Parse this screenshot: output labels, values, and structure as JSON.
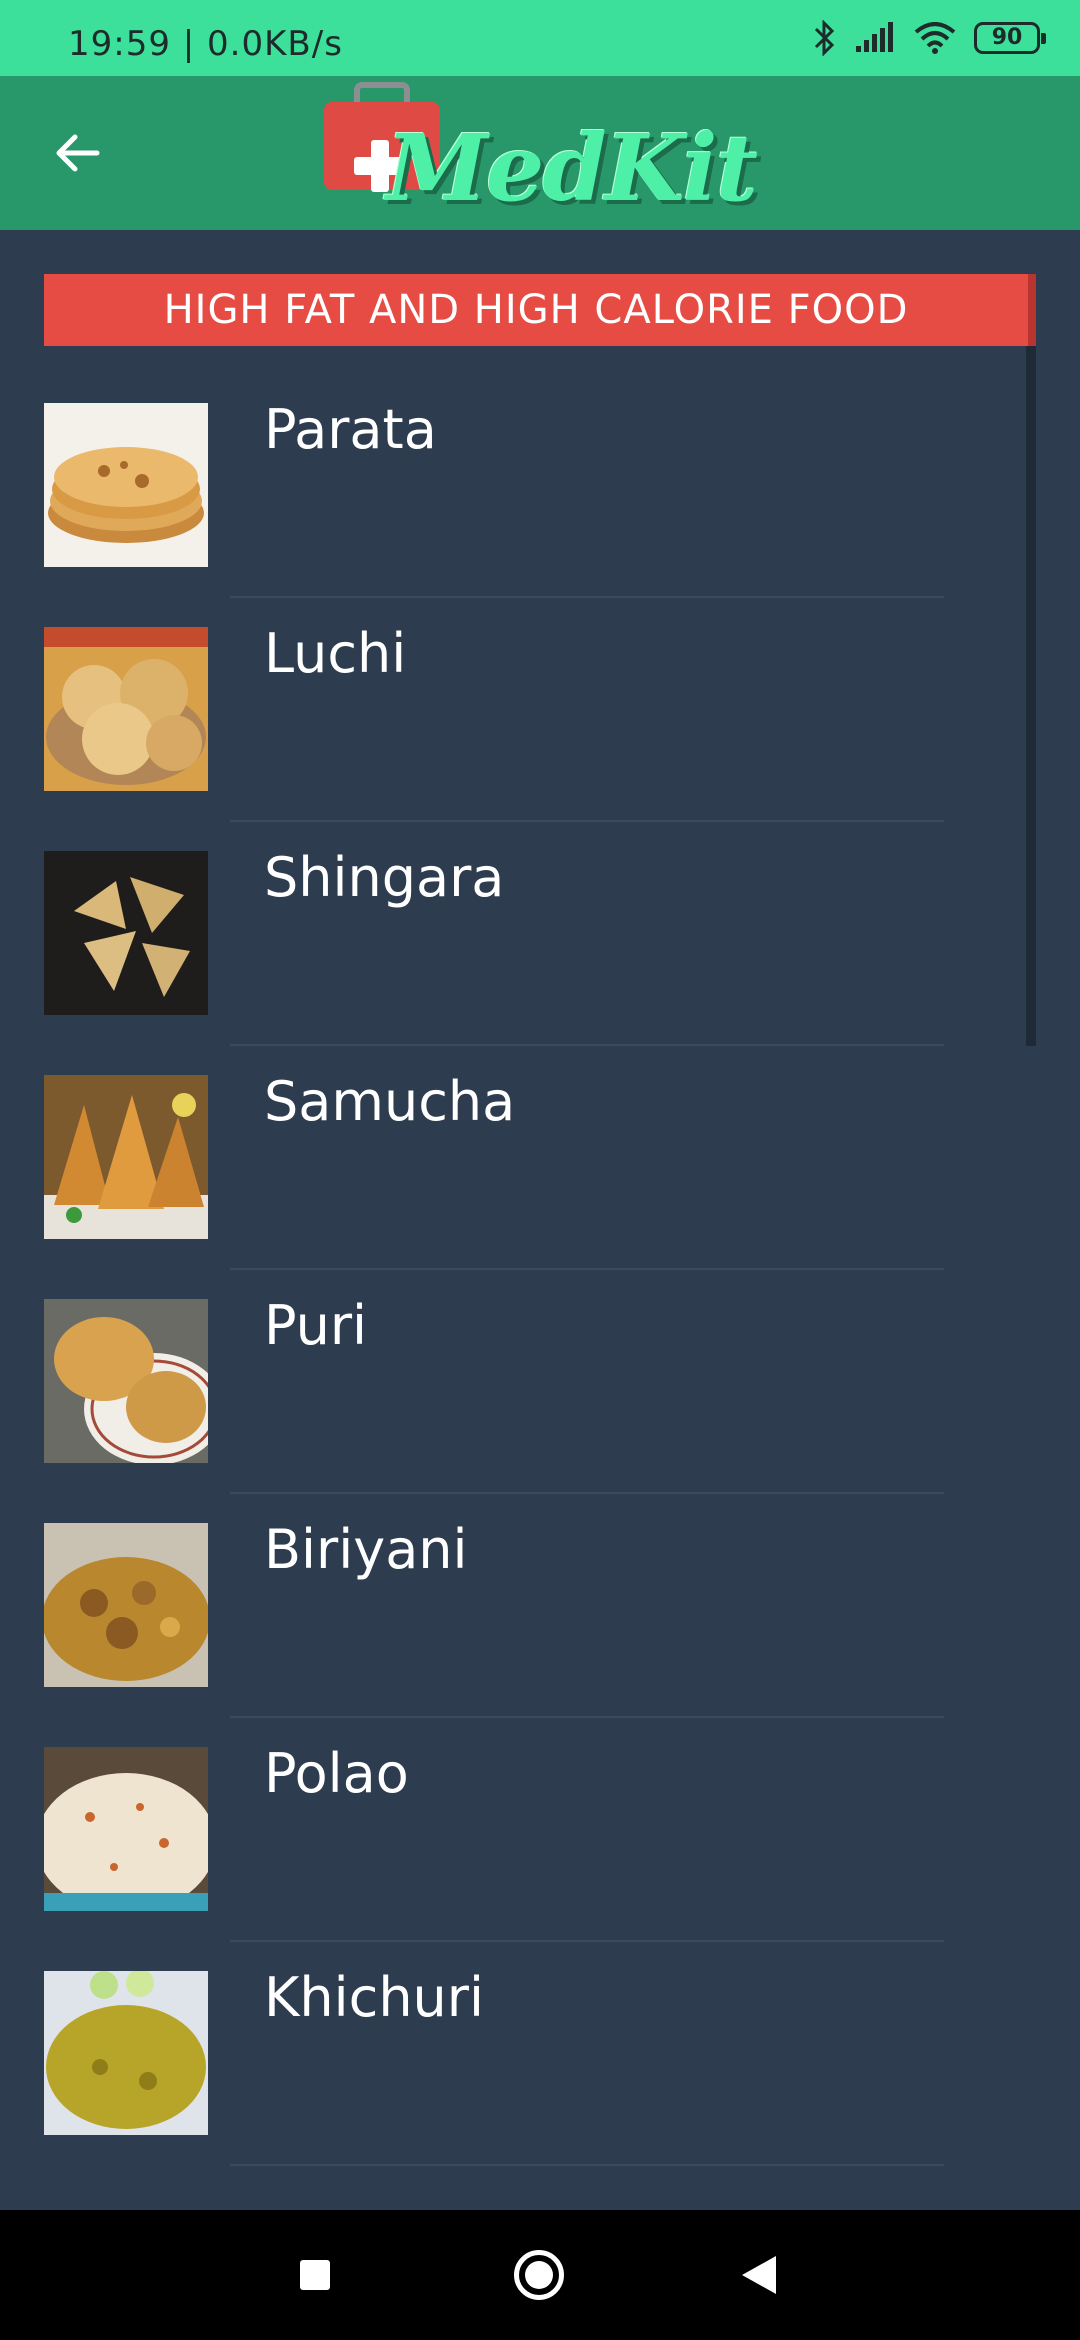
{
  "status_bar": {
    "time_speed": "19:59 | 0.0KB/s",
    "battery_level": "90",
    "icons": [
      "bluetooth-icon",
      "signal-icon",
      "wifi-icon",
      "battery-icon"
    ]
  },
  "app_bar": {
    "logo_text": "MedKit",
    "back_icon": "arrow-left-icon"
  },
  "section": {
    "title": "HIGH FAT AND HIGH CALORIE FOOD",
    "accent_color": "#e74c44"
  },
  "foods": [
    {
      "label": "Parata"
    },
    {
      "label": "Luchi"
    },
    {
      "label": "Shingara"
    },
    {
      "label": "Samucha"
    },
    {
      "label": "Puri"
    },
    {
      "label": "Biriyani"
    },
    {
      "label": "Polao"
    },
    {
      "label": "Khichuri"
    }
  ],
  "nav_bar": {
    "icons": [
      "recents-square-icon",
      "home-circle-icon",
      "back-triangle-icon"
    ]
  },
  "colors": {
    "status_bar": "#3ce09b",
    "app_bar": "#28986a",
    "background": "#2d3c4f"
  }
}
